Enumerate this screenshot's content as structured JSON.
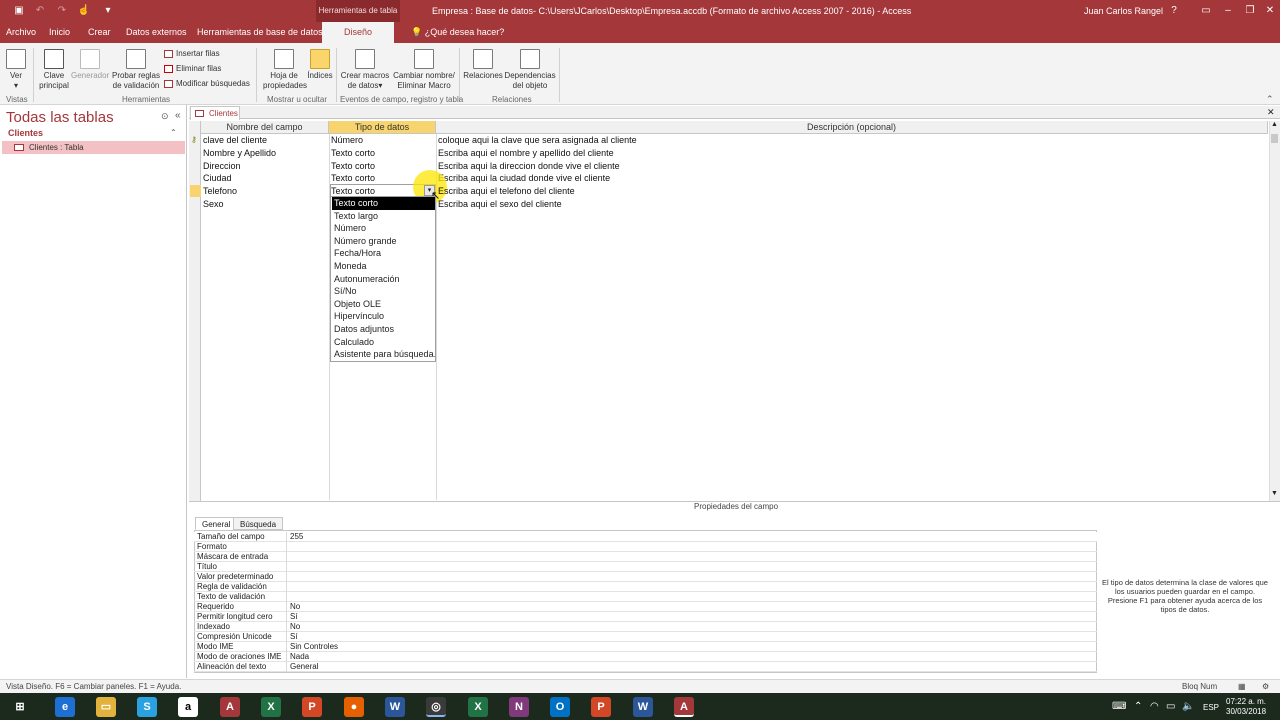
{
  "titlebar": {
    "context_band": "Herramientas de tabla",
    "title": "Empresa : Base de datos- C:\\Users\\JCarlos\\Desktop\\Empresa.accdb (Formato de archivo Access 2007 - 2016)  -  Access",
    "user": "Juan Carlos Rangel",
    "help": "?"
  },
  "tabs": {
    "archivo": "Archivo",
    "inicio": "Inicio",
    "crear": "Crear",
    "datos_externos": "Datos externos",
    "herramientas_bd": "Herramientas de base de datos",
    "diseno": "Diseño",
    "tell_me": "¿Qué desea hacer?"
  },
  "ribbon": {
    "ver": "Ver",
    "clave": "Clave principal",
    "generador": "Generador",
    "probar": "Probar reglas de validación",
    "insertar_filas": "Insertar filas",
    "eliminar_filas": "Eliminar filas",
    "modificar_busquedas": "Modificar búsquedas",
    "hoja": "Hoja de propiedades",
    "indices": "Índices",
    "crear_macros": "Crear macros de datos",
    "cambiar_nombre": "Cambiar nombre/ Eliminar Macro",
    "relaciones": "Relaciones",
    "dependencias": "Dependencias del objeto",
    "groups": {
      "vistas": "Vistas",
      "herramientas": "Herramientas",
      "mostrar": "Mostrar u ocultar",
      "eventos": "Eventos de campo, registro y tabla",
      "relaciones": "Relaciones"
    }
  },
  "nav": {
    "title": "Todas las tablas",
    "section": "Clientes",
    "item": "Clientes : Tabla"
  },
  "doc_tab": "Clientes",
  "grid": {
    "headers": [
      "Nombre del campo",
      "Tipo de datos",
      "Descripción (opcional)"
    ],
    "rows": [
      {
        "name": "clave del cliente",
        "type": "Número",
        "desc": "coloque aqui la clave que sera asignada al cliente"
      },
      {
        "name": "Nombre y Apellido",
        "type": "Texto corto",
        "desc": "Escriba aqui el nombre y apellido del cliente"
      },
      {
        "name": "Direccion",
        "type": "Texto corto",
        "desc": "Escriba aqui la direccion donde vive el cliente"
      },
      {
        "name": "Ciudad",
        "type": "Texto corto",
        "desc": "Escriba aqui la ciudad donde vive el cliente"
      },
      {
        "name": "Telefono",
        "type": "Texto corto",
        "desc": "Escriba aqui el telefono del cliente"
      },
      {
        "name": "Sexo",
        "type": "",
        "desc": "Escriba aqui el sexo del cliente"
      }
    ]
  },
  "dropdown": {
    "options": [
      "Texto corto",
      "Texto largo",
      "Número",
      "Número grande",
      "Fecha/Hora",
      "Moneda",
      "Autonumeración",
      "Sí/No",
      "Objeto OLE",
      "Hipervínculo",
      "Datos adjuntos",
      "Calculado",
      "Asistente para búsqueda..."
    ],
    "selected": "Texto corto"
  },
  "properties": {
    "title": "Propiedades del campo",
    "tab_general": "General",
    "tab_busqueda": "Búsqueda",
    "rows": [
      {
        "label": "Tamaño del campo",
        "value": "255"
      },
      {
        "label": "Formato",
        "value": ""
      },
      {
        "label": "Máscara de entrada",
        "value": ""
      },
      {
        "label": "Título",
        "value": ""
      },
      {
        "label": "Valor predeterminado",
        "value": ""
      },
      {
        "label": "Regla de validación",
        "value": ""
      },
      {
        "label": "Texto de validación",
        "value": ""
      },
      {
        "label": "Requerido",
        "value": "No"
      },
      {
        "label": "Permitir longitud cero",
        "value": "Sí"
      },
      {
        "label": "Indexado",
        "value": "No"
      },
      {
        "label": "Compresión Unicode",
        "value": "Sí"
      },
      {
        "label": "Modo IME",
        "value": "Sin Controles"
      },
      {
        "label": "Modo de oraciones IME",
        "value": "Nada"
      },
      {
        "label": "Alineación del texto",
        "value": "General"
      }
    ],
    "help": "El tipo de datos determina la clase de valores que los usuarios pueden guardar en el campo. Presione F1 para obtener ayuda acerca de los tipos de datos."
  },
  "status": {
    "left": "Vista Diseño.  F6 = Cambiar paneles.  F1 = Ayuda.",
    "right": "Bloq Num"
  },
  "taskbar": {
    "lang": "ESP",
    "time": "07:22 a. m.",
    "date": "30/03/2018"
  },
  "colors": {
    "accent": "#a4373a",
    "highlight": "#ffe600"
  }
}
